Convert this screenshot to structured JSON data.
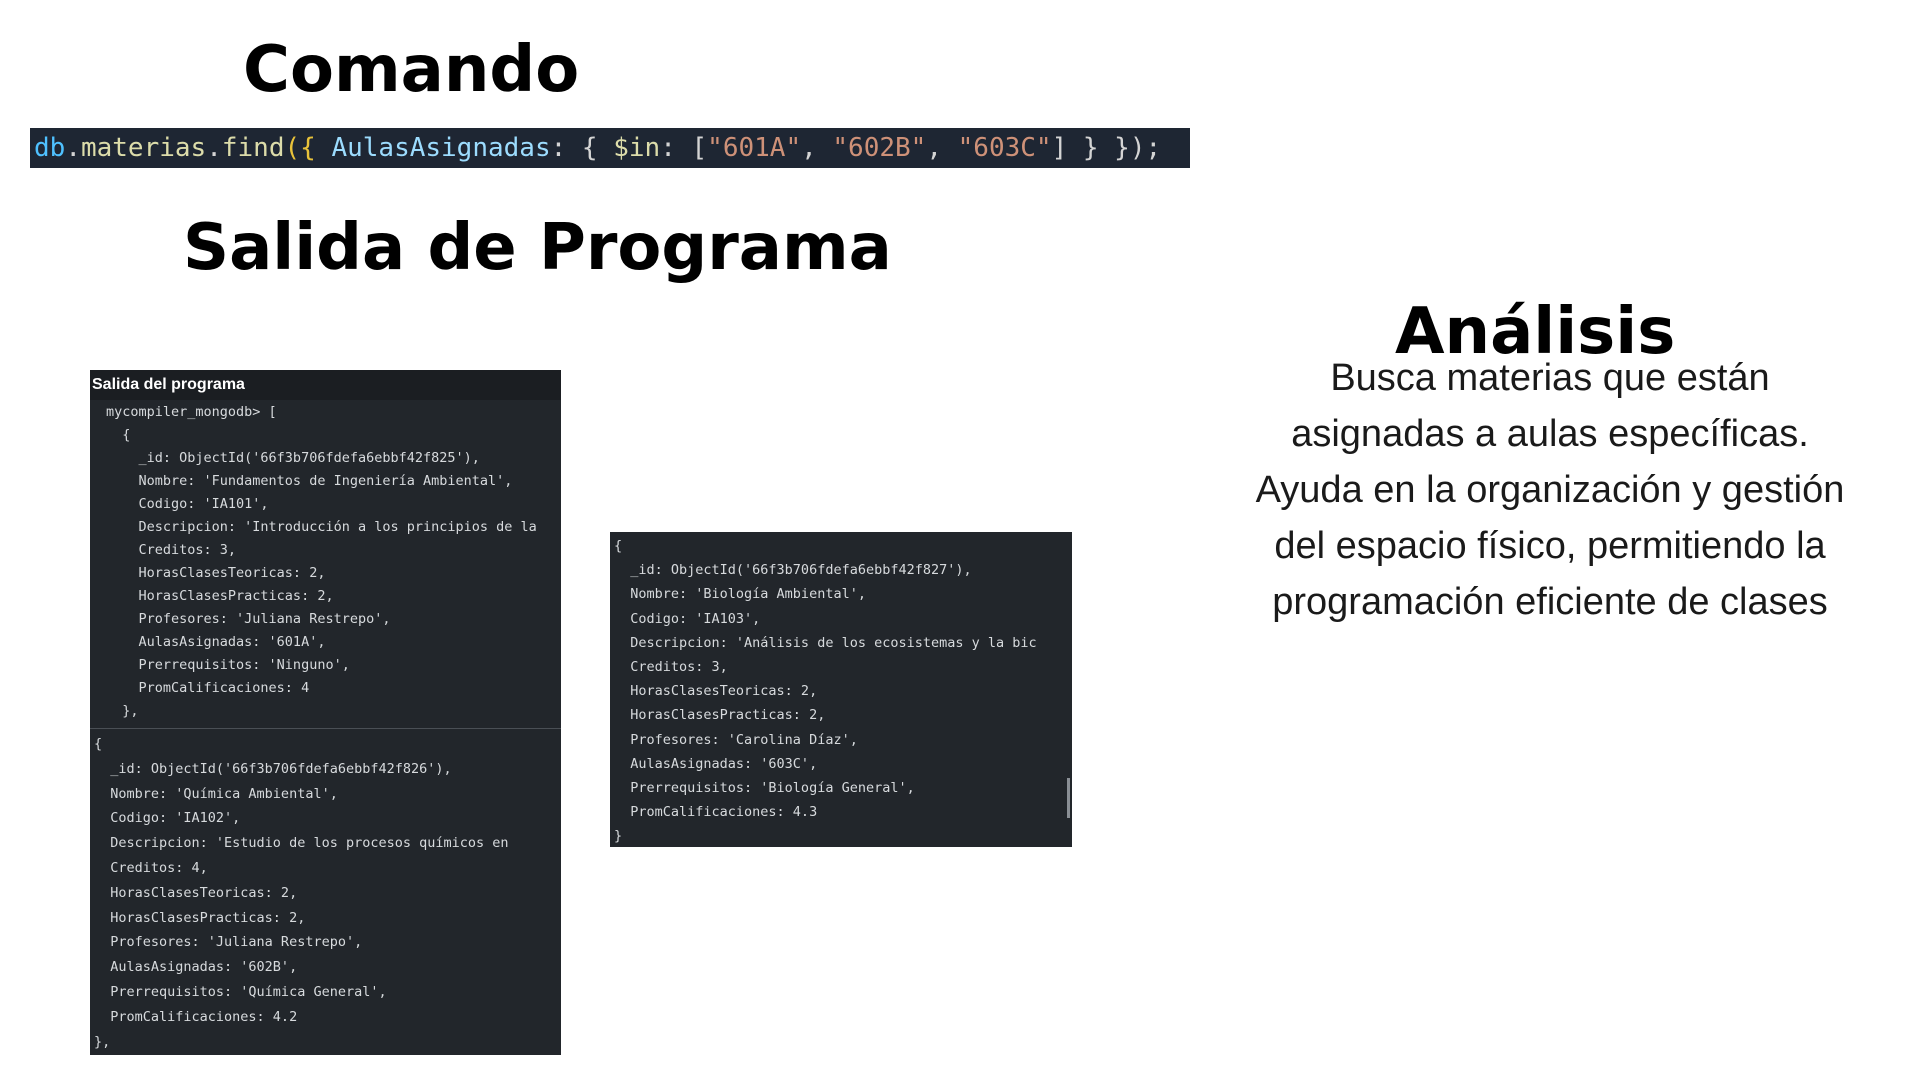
{
  "headings": {
    "command": "Comando",
    "output": "Salida de Programa",
    "analysis": "Análisis"
  },
  "command": {
    "db": "db",
    "dot1": ".",
    "collection": "materias",
    "dot2": ".",
    "method": "find",
    "open": "({ ",
    "field": "AulasAsignadas",
    "colon1": ": { ",
    "operator": "$in",
    "colon2": ": [",
    "value1": "\"601A\"",
    "sep1": ", ",
    "value2": "\"602B\"",
    "sep2": ", ",
    "value3": "\"603C\"",
    "close": "] } });"
  },
  "output": {
    "panel_title": "Salida del programa",
    "prompt_text": "mycompiler_mongodb> [\n  {\n    _id: ObjectId('66f3b706fdefa6ebbf42f825'),\n    Nombre: 'Fundamentos de Ingeniería Ambiental',\n    Codigo: 'IA101',\n    Descripcion: 'Introducción a los principios de la\n    Creditos: 3,\n    HorasClasesTeoricas: 2,\n    HorasClasesPracticas: 2,\n    Profesores: 'Juliana Restrepo',\n    AulasAsignadas: '601A',\n    Prerrequisitos: 'Ninguno',\n    PromCalificaciones: 4\n  },",
    "doc2_text": "{\n  _id: ObjectId('66f3b706fdefa6ebbf42f826'),\n  Nombre: 'Química Ambiental',\n  Codigo: 'IA102',\n  Descripcion: 'Estudio de los procesos químicos en\n  Creditos: 4,\n  HorasClasesTeoricas: 2,\n  HorasClasesPracticas: 2,\n  Profesores: 'Juliana Restrepo',\n  AulasAsignadas: '602B',\n  Prerrequisitos: 'Química General',\n  PromCalificaciones: 4.2\n},",
    "doc3_text": "{\n  _id: ObjectId('66f3b706fdefa6ebbf42f827'),\n  Nombre: 'Biología Ambiental',\n  Codigo: 'IA103',\n  Descripcion: 'Análisis de los ecosistemas y la bic\n  Creditos: 3,\n  HorasClasesTeoricas: 2,\n  HorasClasesPracticas: 2,\n  Profesores: 'Carolina Díaz',\n  AulasAsignadas: '603C',\n  Prerrequisitos: 'Biología General',\n  PromCalificaciones: 4.3\n}"
  },
  "analysis": {
    "lines": [
      "Busca materias que están",
      "asignadas a aulas específicas.",
      "Ayuda en la organización y gestión",
      "del espacio físico, permitiendo la",
      "programación eficiente de clases"
    ]
  }
}
